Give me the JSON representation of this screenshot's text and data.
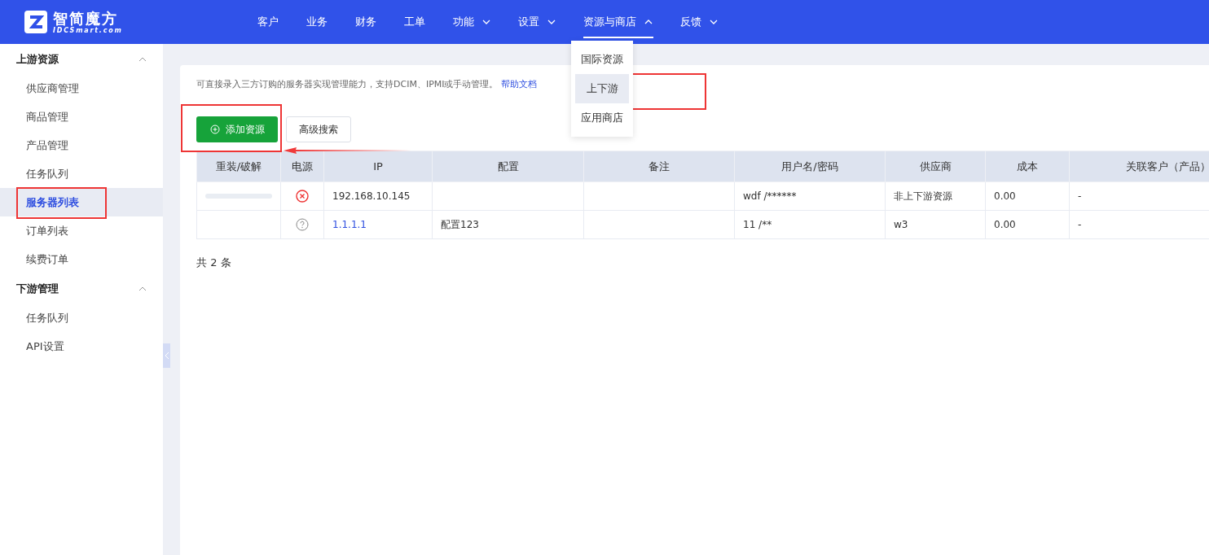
{
  "logo": {
    "name": "智简魔方",
    "domain": "IDCSmart.com"
  },
  "nav": [
    {
      "label": "客户",
      "dropdown": false,
      "expanded": false
    },
    {
      "label": "业务",
      "dropdown": false,
      "expanded": false
    },
    {
      "label": "财务",
      "dropdown": false,
      "expanded": false
    },
    {
      "label": "工单",
      "dropdown": false,
      "expanded": false
    },
    {
      "label": "功能",
      "dropdown": true,
      "expanded": false
    },
    {
      "label": "设置",
      "dropdown": true,
      "expanded": false
    },
    {
      "label": "资源与商店",
      "dropdown": true,
      "expanded": true
    },
    {
      "label": "反馈",
      "dropdown": true,
      "expanded": false
    }
  ],
  "nav_menu": [
    {
      "label": "国际资源",
      "selected": false
    },
    {
      "label": "上下游",
      "selected": true
    },
    {
      "label": "应用商店",
      "selected": false
    }
  ],
  "sidebar": [
    {
      "label": "上游资源",
      "expanded": true,
      "children": [
        {
          "label": "供应商管理",
          "selected": false
        },
        {
          "label": "商品管理",
          "selected": false
        },
        {
          "label": "产品管理",
          "selected": false
        },
        {
          "label": "任务队列",
          "selected": false
        },
        {
          "label": "服务器列表",
          "selected": true
        },
        {
          "label": "订单列表",
          "selected": false
        },
        {
          "label": "续费订单",
          "selected": false
        }
      ]
    },
    {
      "label": "下游管理",
      "expanded": true,
      "children": [
        {
          "label": "任务队列",
          "selected": false
        },
        {
          "label": "API设置",
          "selected": false
        }
      ]
    }
  ],
  "notice": {
    "text": "可直接录入三方订购的服务器实现管理能力，支持DCIM、IPMI或手动管理。",
    "link": "帮助文档"
  },
  "buttons": {
    "add": "添加资源",
    "search": "高级搜索"
  },
  "table": {
    "columns": [
      "重装/破解",
      "电源",
      "IP",
      "配置",
      "备注",
      "用户名/密码",
      "供应商",
      "成本",
      "关联客户（产品）"
    ],
    "rows": [
      {
        "reinstall_loading": true,
        "power": {
          "kind": "off"
        },
        "ip": "192.168.10.145",
        "ip_link": false,
        "credentials": "wdf /******",
        "supplier": "非上下游资源",
        "cost": "0.00",
        "customer": "-"
      },
      {
        "reinstall_loading": false,
        "power": {
          "kind": "unknown"
        },
        "ip": "1.1.1.1",
        "ip_link": true,
        "config": "配置123",
        "credentials": "11 /**",
        "supplier": "w3",
        "cost": "0.00",
        "customer": "-"
      }
    ]
  },
  "total": "共 2 条"
}
